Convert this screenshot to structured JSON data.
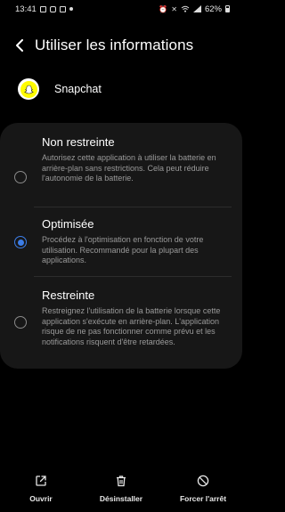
{
  "status_bar": {
    "time": "13:41",
    "battery": "62%",
    "left_icons": [
      "gallery-icon",
      "instagram-icon",
      "message-icon",
      "dot-icon"
    ],
    "right_icons": [
      "alarm-icon",
      "mute-icon",
      "wifi-icon",
      "signal-icon",
      "battery-icon"
    ]
  },
  "header": {
    "title": "Utiliser les informations"
  },
  "app": {
    "name": "Snapchat",
    "icon_color": "#FFFC00"
  },
  "options": [
    {
      "title": "Non restreinte",
      "description": "Autorisez cette application à utiliser la batterie en arrière-plan sans restrictions. Cela peut réduire l'autonomie de la batterie.",
      "selected": false
    },
    {
      "title": "Optimisée",
      "description": "Procédez à l'optimisation en fonction de votre utilisation. Recommandé pour la plupart des applications.",
      "selected": true
    },
    {
      "title": "Restreinte",
      "description": "Restreignez l'utilisation de la batterie lorsque cette application s'exécute en arrière-plan. L'application risque de ne pas fonctionner comme prévu et les notifications risquent d'être retardées.",
      "selected": false
    }
  ],
  "actions": {
    "open": "Ouvrir",
    "uninstall": "Désinstaller",
    "force_stop": "Forcer l'arrêt"
  },
  "colors": {
    "accent": "#3D7EE8",
    "card_bg": "#171717",
    "background": "#000000"
  }
}
